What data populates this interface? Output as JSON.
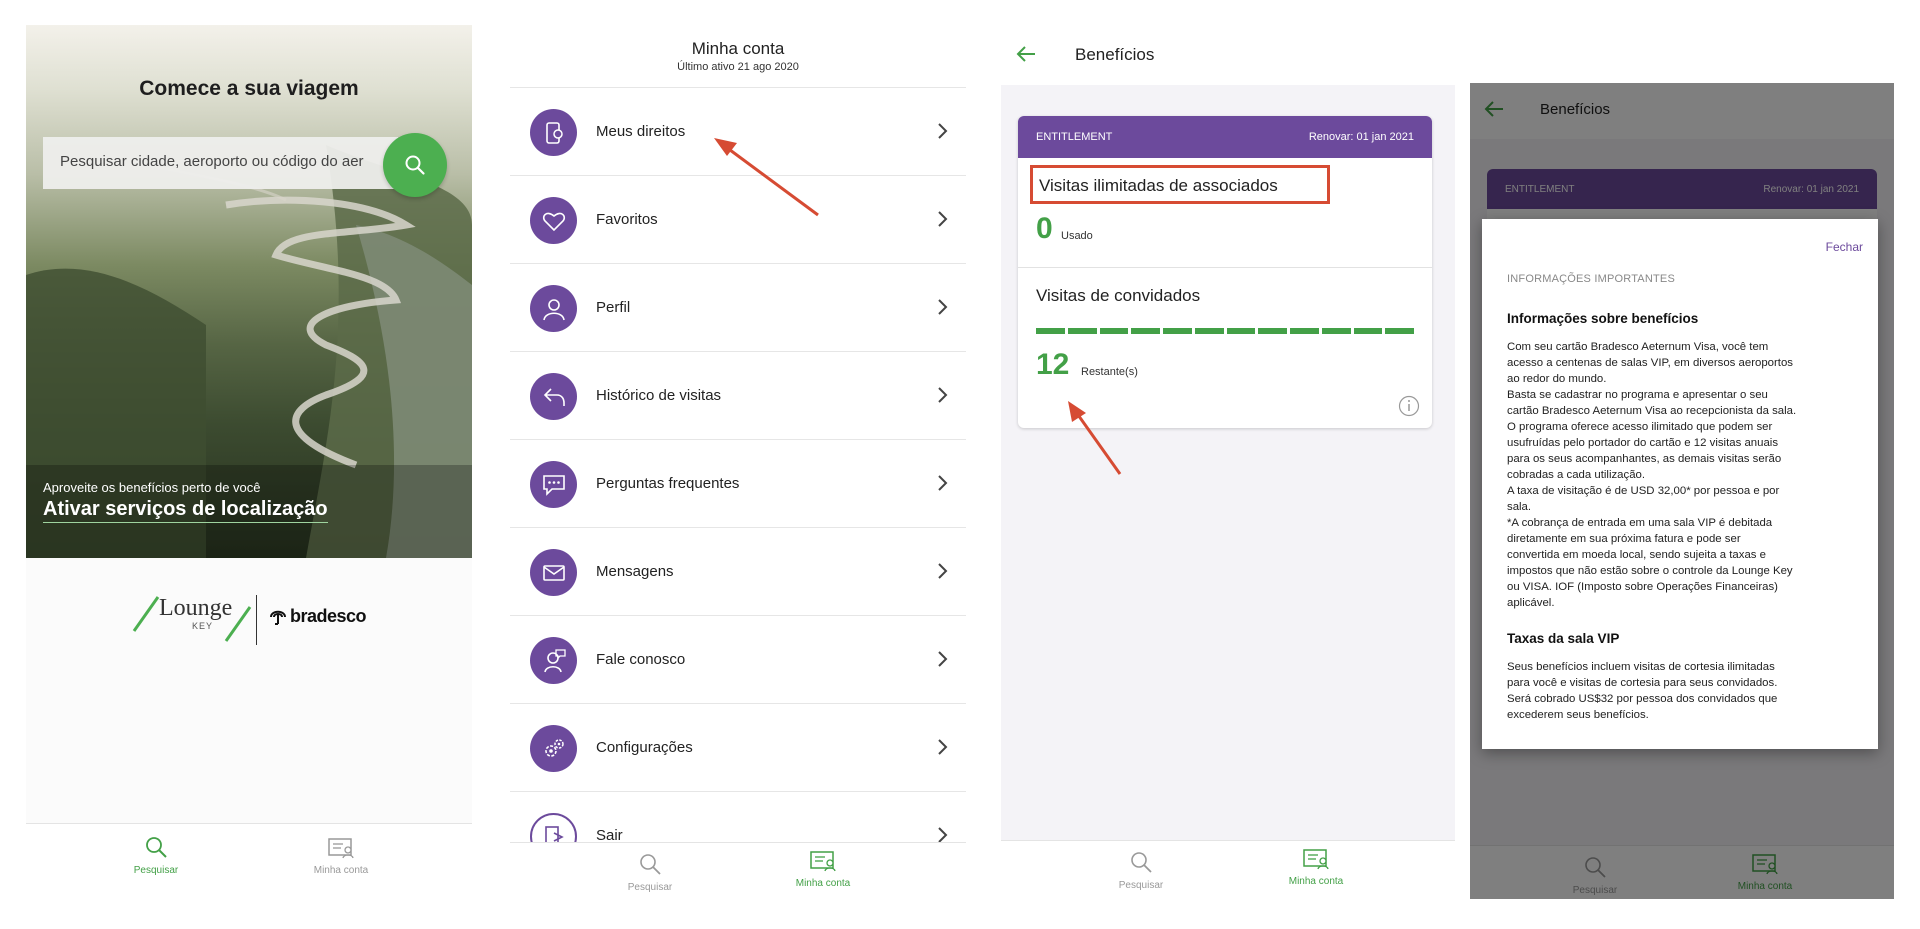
{
  "panel1": {
    "title": "Comece a sua viagem",
    "search_placeholder": "Pesquisar cidade, aeroporto ou código do aer",
    "location_sub": "Aproveite os benefícios perto de você",
    "location_main": "Ativar serviços de localização",
    "logo_lounge": "Lounge",
    "logo_key": "KEY",
    "logo_bank": "bradesco",
    "tabs": [
      {
        "label": "Pesquisar",
        "icon": "search-icon",
        "active": true
      },
      {
        "label": "Minha conta",
        "icon": "account-icon",
        "active": false
      }
    ]
  },
  "panel2": {
    "title": "Minha conta",
    "subtitle": "Último ativo 21 ago 2020",
    "menu": [
      {
        "label": "Meus direitos",
        "icon": "rights-card-icon"
      },
      {
        "label": "Favoritos",
        "icon": "heart-icon"
      },
      {
        "label": "Perfil",
        "icon": "profile-icon"
      },
      {
        "label": "Histórico de visitas",
        "icon": "history-icon"
      },
      {
        "label": "Perguntas frequentes",
        "icon": "faq-chat-icon"
      },
      {
        "label": "Mensagens",
        "icon": "envelope-icon"
      },
      {
        "label": "Fale conosco",
        "icon": "contact-icon"
      },
      {
        "label": "Configurações",
        "icon": "settings-icon"
      },
      {
        "label": "Sair",
        "icon": "logout-icon"
      }
    ],
    "tabs": [
      {
        "label": "Pesquisar",
        "icon": "search-icon",
        "active": false
      },
      {
        "label": "Minha conta",
        "icon": "account-icon",
        "active": true
      }
    ]
  },
  "panel3": {
    "title": "Benefícios",
    "card_header_left": "ENTITLEMENT",
    "card_header_right": "Renovar: 01 jan 2021",
    "members_title": "Visitas ilimitadas de associados",
    "members_used_value": "0",
    "members_used_label": "Usado",
    "guests_title": "Visitas de convidados",
    "guests_total": 12,
    "guests_remaining_value": "12",
    "guests_remaining_label": "Restante(s)",
    "tabs": [
      {
        "label": "Pesquisar",
        "icon": "search-icon",
        "active": false
      },
      {
        "label": "Minha conta",
        "icon": "account-icon",
        "active": true
      }
    ]
  },
  "panel4": {
    "title": "Benefícios",
    "card_header_left": "ENTITLEMENT",
    "card_header_right": "Renovar: 01 jan 2021",
    "close_label": "Fechar",
    "important_label": "INFORMAÇÕES IMPORTANTES",
    "section1_title": "Informações sobre benefícios",
    "section1_lines": [
      "Com seu cartão Bradesco Aeternum Visa, você tem",
      "acesso a centenas de salas VIP, em diversos aeroportos",
      "ao redor do mundo.",
      "Basta se cadastrar no programa e apresentar o seu",
      "cartão Bradesco Aeternum Visa ao recepcionista da sala.",
      "O programa oferece acesso ilimitado que podem ser",
      "usufruídas pelo portador do cartão e 12 visitas anuais",
      "para os seus acompanhantes, as demais visitas serão",
      "cobradas a cada utilização.",
      "A taxa de visitação é de USD 32,00* por pessoa e por",
      "sala.",
      "*A cobrança de entrada em uma sala VIP é debitada",
      "diretamente em sua próxima fatura e pode ser",
      "convertida em moeda local, sendo sujeita a taxas e",
      "impostos que não estão sobre o controle da Lounge Key",
      "ou VISA. IOF (Imposto sobre Operações Financeiras)",
      "aplicável."
    ],
    "section2_title": "Taxas da sala VIP",
    "section2_lines": [
      "Seus benefícios incluem visitas de cortesia ilimitadas",
      "para você e visitas de cortesia para seus convidados.",
      "Será cobrado US$32 por pessoa dos convidados que",
      "excederem seus benefícios."
    ],
    "tabs": [
      {
        "label": "Pesquisar",
        "icon": "search-icon",
        "active": false
      },
      {
        "label": "Minha conta",
        "icon": "account-icon",
        "active": true
      }
    ]
  },
  "colors": {
    "brand_purple": "#6c4a9c",
    "accent_green": "#43a047",
    "highlight_red": "#d64b33"
  }
}
